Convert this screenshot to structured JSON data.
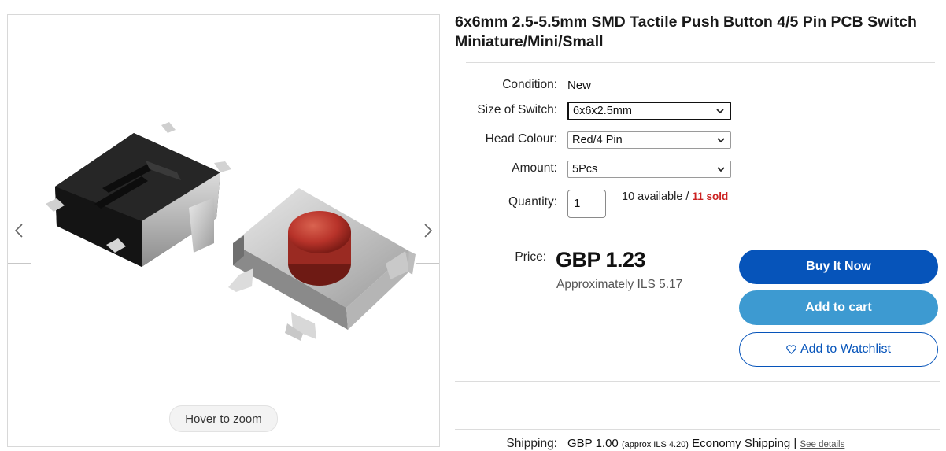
{
  "gallery": {
    "zoom_hint": "Hover to zoom",
    "prev_icon": "chevron-left-icon",
    "next_icon": "chevron-right-icon"
  },
  "listing": {
    "title": "6x6mm 2.5-5.5mm SMD Tactile Push Button 4/5 Pin PCB Switch Miniature/Mini/Small"
  },
  "specifics": {
    "condition_label": "Condition:",
    "condition_value": "New",
    "size_label": "Size of Switch:",
    "size_value": "6x6x2.5mm",
    "colour_label": "Head Colour:",
    "colour_value": "Red/4 Pin",
    "amount_label": "Amount:",
    "amount_value": "5Pcs",
    "quantity_label": "Quantity:",
    "quantity_value": "1",
    "available_text": "10 available / ",
    "sold_text": "11 sold"
  },
  "pricing": {
    "price_label": "Price:",
    "price": "GBP 1.23",
    "approx": "Approximately ILS 5.17"
  },
  "actions": {
    "buy_now": "Buy It Now",
    "add_to_cart": "Add to cart",
    "watchlist": "Add to Watchlist",
    "watch_icon": "heart-icon"
  },
  "shipping": {
    "label": "Shipping:",
    "price": "GBP 1.00",
    "approx": "(approx ILS 4.20)",
    "method": "Economy Shipping |",
    "details_link": "See details"
  },
  "colors": {
    "buy_now_bg": "#0654ba",
    "add_to_cart_bg": "#3d9ad1",
    "sold_red": "#cc2222"
  }
}
